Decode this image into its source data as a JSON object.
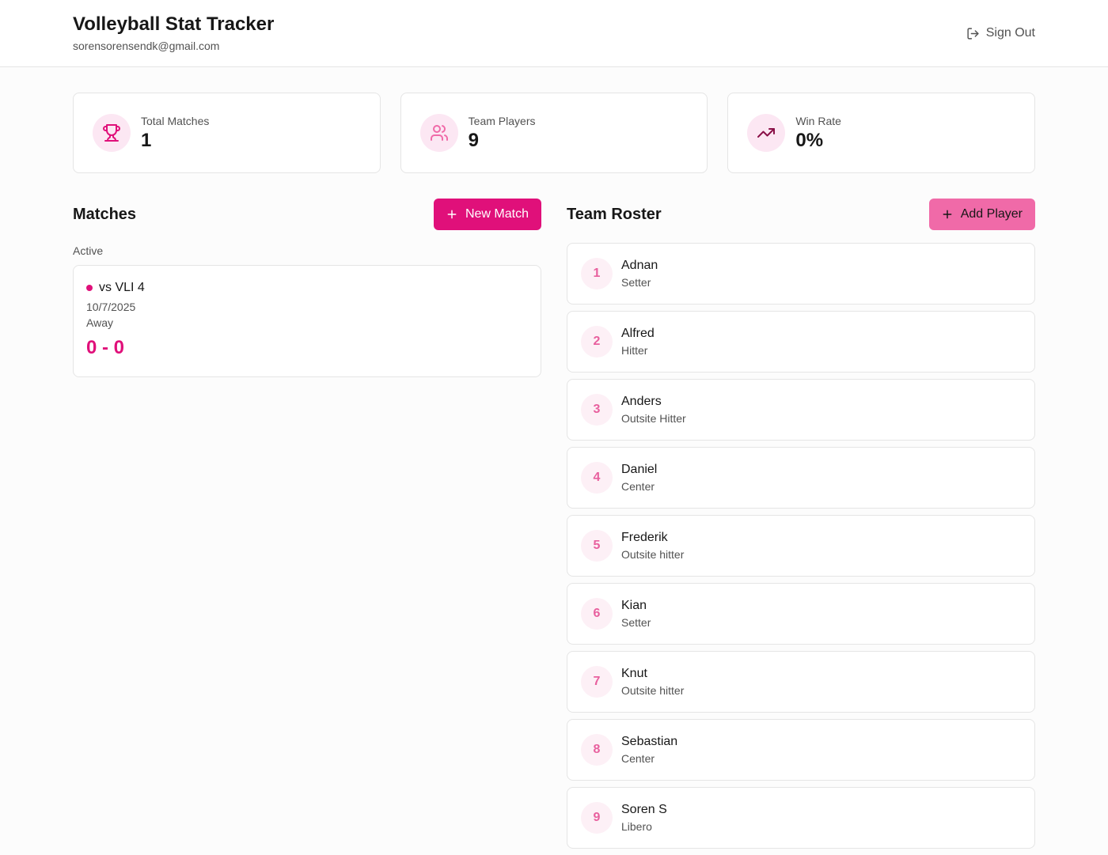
{
  "header": {
    "title": "Volleyball Stat Tracker",
    "email": "sorensorensendk@gmail.com",
    "signout_label": "Sign Out"
  },
  "stats": [
    {
      "label": "Total Matches",
      "value": "1",
      "icon": "trophy-icon"
    },
    {
      "label": "Team Players",
      "value": "9",
      "icon": "users-icon"
    },
    {
      "label": "Win Rate",
      "value": "0%",
      "icon": "trending-up-icon"
    }
  ],
  "matches": {
    "title": "Matches",
    "new_button": "New Match",
    "group_label": "Active",
    "items": [
      {
        "name": "vs VLI 4",
        "date": "10/7/2025",
        "venue": "Away",
        "score": "0 - 0"
      }
    ]
  },
  "roster": {
    "title": "Team Roster",
    "add_button": "Add Player",
    "players": [
      {
        "number": "1",
        "name": "Adnan",
        "position": "Setter"
      },
      {
        "number": "2",
        "name": "Alfred",
        "position": "Hitter"
      },
      {
        "number": "3",
        "name": "Anders",
        "position": "Outsite Hitter"
      },
      {
        "number": "4",
        "name": "Daniel",
        "position": "Center"
      },
      {
        "number": "5",
        "name": "Frederik",
        "position": "Outsite hitter"
      },
      {
        "number": "6",
        "name": "Kian",
        "position": "Setter"
      },
      {
        "number": "7",
        "name": "Knut",
        "position": "Outsite hitter"
      },
      {
        "number": "8",
        "name": "Sebastian",
        "position": "Center"
      },
      {
        "number": "9",
        "name": "Soren S",
        "position": "Libero"
      }
    ]
  },
  "colors": {
    "accent": "#e0107a",
    "accent_light": "#f06aa8",
    "icon_bg": "#fce7f3"
  }
}
